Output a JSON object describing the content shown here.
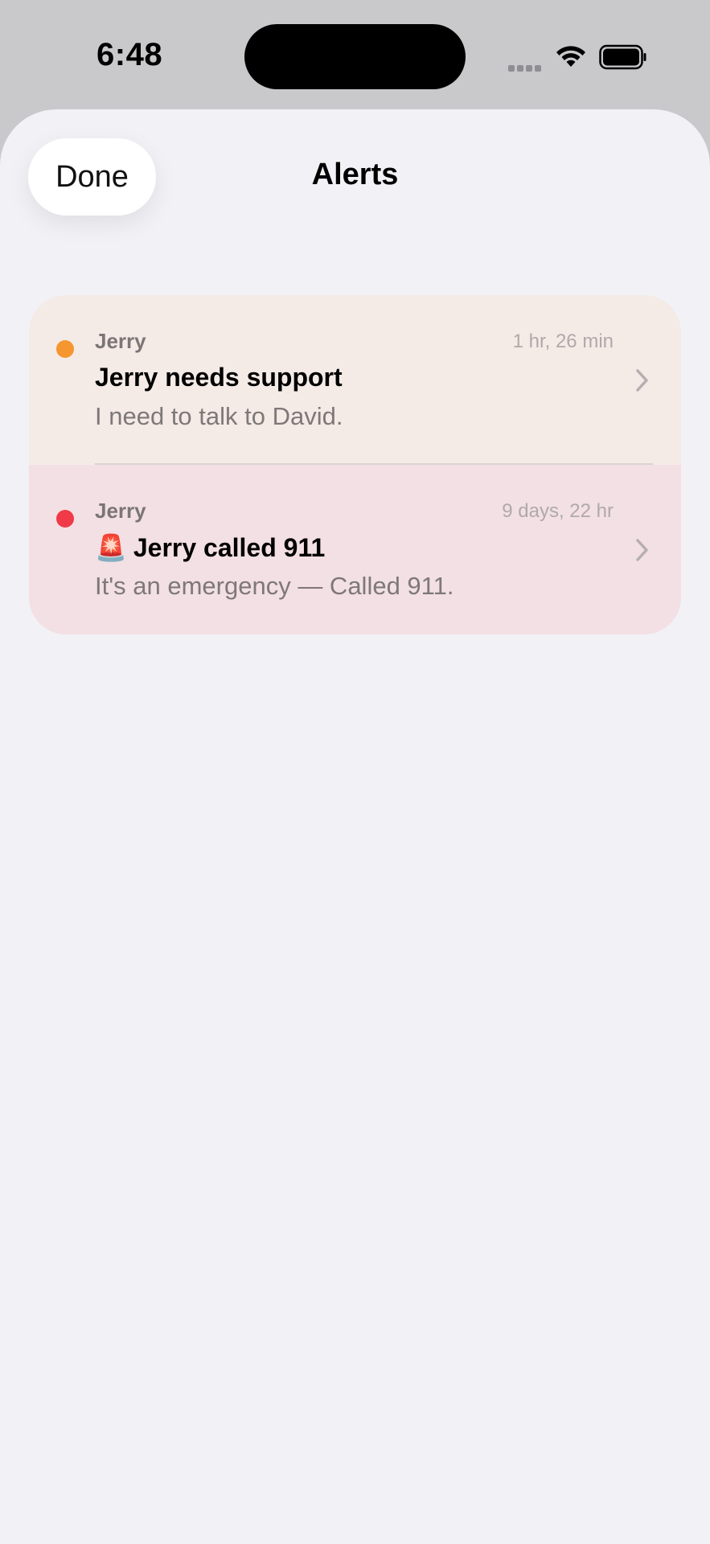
{
  "status_bar": {
    "time": "6:48",
    "icons": [
      "cellular-signal-icon",
      "wifi-icon",
      "battery-icon"
    ]
  },
  "header": {
    "done_label": "Done",
    "title": "Alerts"
  },
  "alerts": [
    {
      "sender": "Jerry",
      "time": "1 hr, 26 min",
      "title": "Jerry needs support",
      "body": "I need to talk to David.",
      "dot_color": "#f5962e",
      "background": "#f4ebe6"
    },
    {
      "sender": "Jerry",
      "time": "9 days, 22 hr",
      "title_icon": "🚨",
      "title": "Jerry called 911",
      "body": "It's an emergency — Called 911.",
      "dot_color": "#f03a48",
      "background": "#f3e0e4"
    }
  ],
  "colors": {
    "sheet_background": "#f2f1f6",
    "status_background": "#c9c9cb"
  }
}
